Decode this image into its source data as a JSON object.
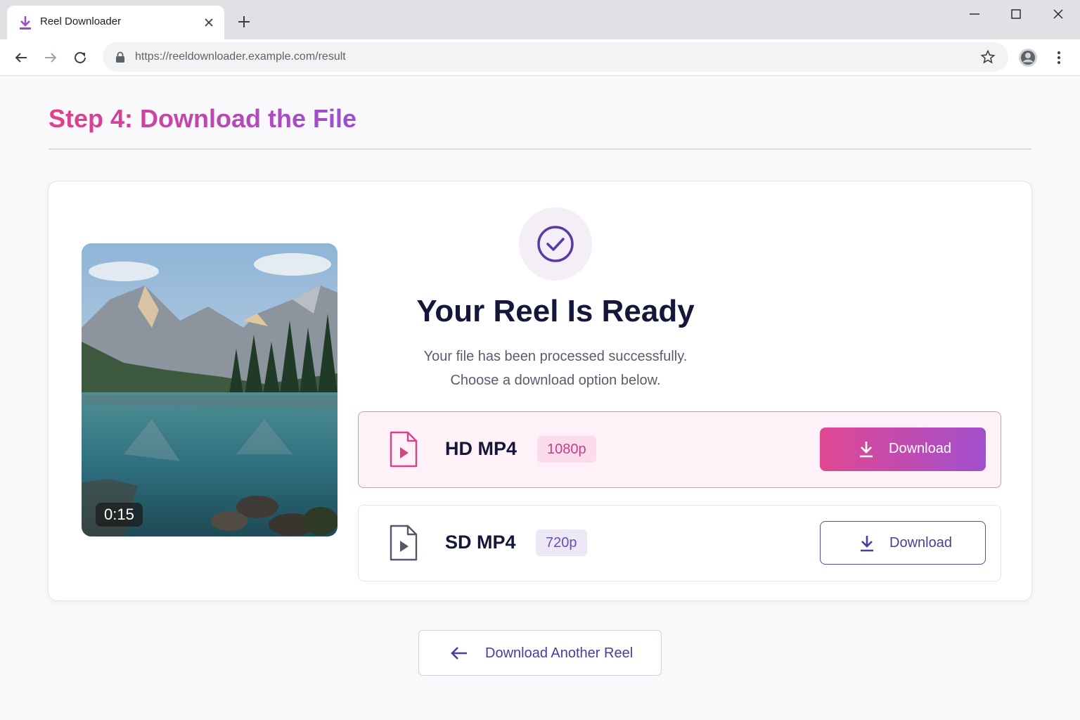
{
  "browser": {
    "tab_title": "Reel Downloader",
    "url": "https://reeldownloader.example.com/result",
    "icons": [
      "download-favicon-icon",
      "close-icon",
      "plus-icon",
      "minimize-icon",
      "maximize-icon",
      "close-window-icon",
      "back-arrow-icon",
      "forward-arrow-icon",
      "reload-icon",
      "lock-icon",
      "star-icon",
      "profile-icon",
      "more-vert-icon"
    ]
  },
  "page": {
    "title": "Step 4: Download the File",
    "accent_gradient": [
      "#e0408a",
      "#9a4fd1"
    ]
  },
  "result": {
    "preview_duration": "0:15",
    "status_icon": "check-circle-icon",
    "heading": "Your Reel Is Ready",
    "subtitle_line1": "Your file has been processed successfully.",
    "subtitle_line2": "Choose a download option below."
  },
  "options": [
    {
      "label": "HD MP4",
      "resolution": "1080p",
      "button_label": "Download",
      "icon": "video-file-icon"
    },
    {
      "label": "SD MP4",
      "resolution": "720p",
      "button_label": "Download",
      "icon": "video-file-icon"
    }
  ],
  "footer": {
    "another_label": "Download Another Reel"
  }
}
